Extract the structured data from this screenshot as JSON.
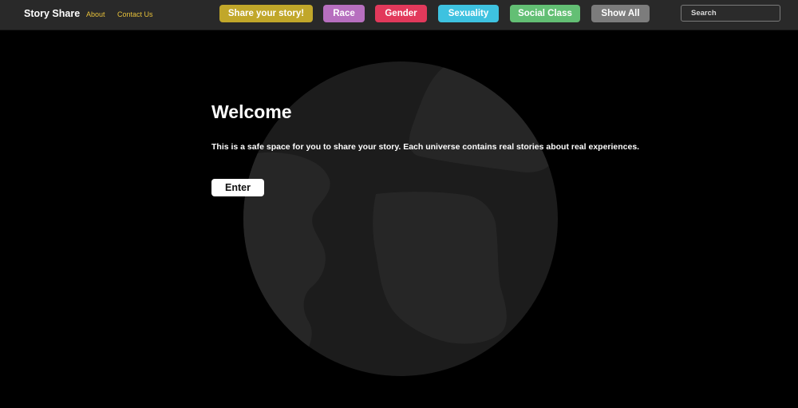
{
  "navbar": {
    "brand": "Story Share",
    "links": {
      "about": "About",
      "contact": "Contact Us"
    },
    "link_color": "#e6c03a",
    "categories": [
      {
        "label": "Share your story!",
        "color": "#c1a72a"
      },
      {
        "label": "Race",
        "color": "#b76fbf"
      },
      {
        "label": "Gender",
        "color": "#e2395b"
      },
      {
        "label": "Sexuality",
        "color": "#3ec2e0"
      },
      {
        "label": "Social Class",
        "color": "#63bf74"
      },
      {
        "label": "Show All",
        "color": "#7c7c7c"
      }
    ],
    "search": {
      "placeholder": "Search",
      "value": ""
    }
  },
  "hero": {
    "title": "Welcome",
    "text": "This is a safe space for you to share your story. Each universe contains real stories about real experiences.",
    "button": "Enter"
  },
  "globe": {
    "icon": "globe-icon",
    "ocean_color": "#1c1c1c",
    "land_color": "#262626"
  }
}
